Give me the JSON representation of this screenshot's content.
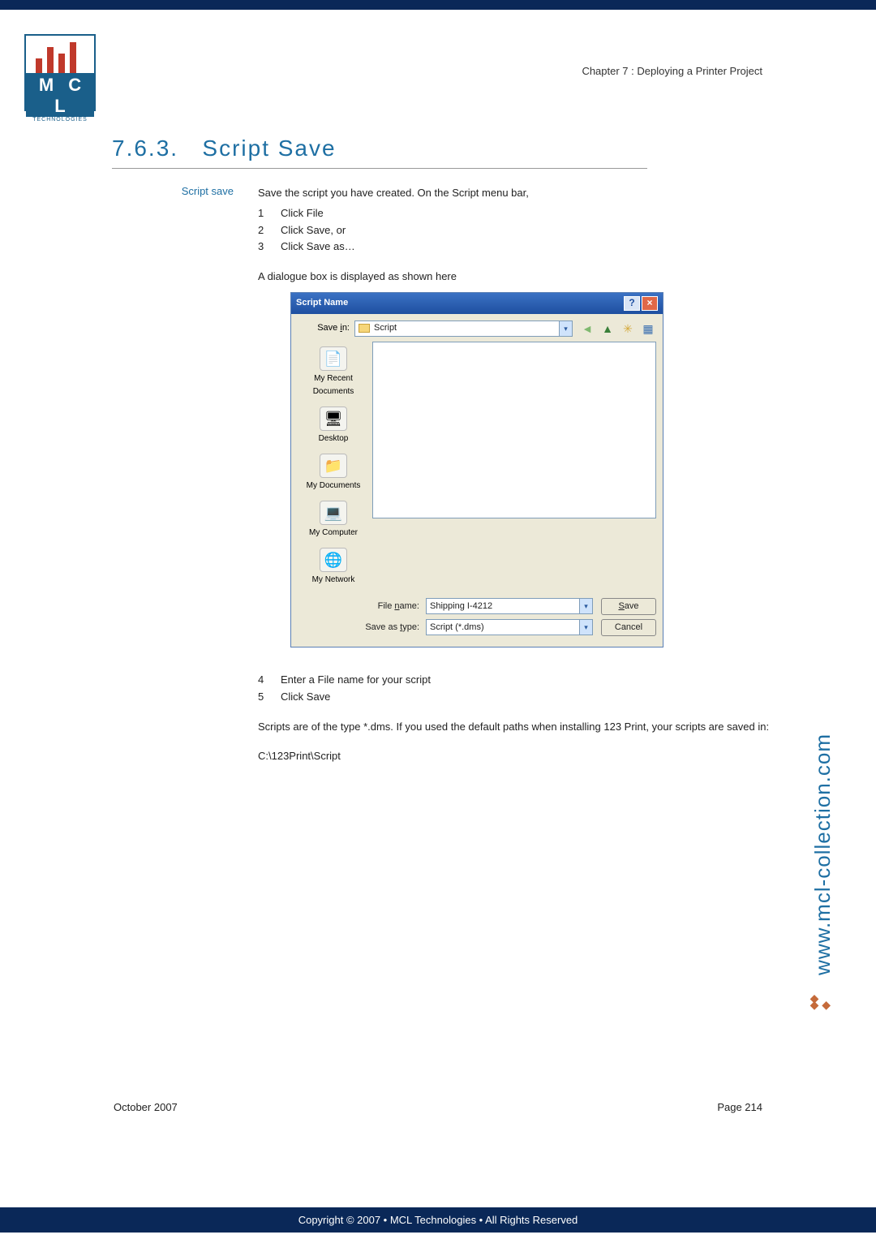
{
  "header": {
    "chapter": "Chapter 7 : Deploying a Printer Project"
  },
  "logo": {
    "initials": "M C L",
    "sub": "TECHNOLOGIES"
  },
  "section": {
    "number": "7.6.3.",
    "title": "Script Save"
  },
  "leftLabel": "Script save",
  "body": {
    "intro": "Save the script you have created. On the Script menu bar,",
    "steps1": [
      {
        "n": "1",
        "t": "Click File"
      },
      {
        "n": "2",
        "t": "Click Save, or"
      },
      {
        "n": "3",
        "t": "Click Save as…"
      }
    ],
    "dlgNote": "A dialogue box is displayed as shown here",
    "steps2": [
      {
        "n": "4",
        "t": "Enter a File name for your script"
      },
      {
        "n": "5",
        "t": "Click Save"
      }
    ],
    "pathnote": "Scripts are of the type *.dms. If you used the default paths when installing 123 Print, your scripts are saved in:",
    "codepath": "C:\\123Print\\Script"
  },
  "dialog": {
    "title": "Script Name",
    "saveInLabel": "Save in:",
    "saveInValue": "Script",
    "places": [
      "My Recent Documents",
      "Desktop",
      "My Documents",
      "My Computer",
      "My Network"
    ],
    "fileNameLabel": "File name:",
    "fileNameValue": "Shipping I-4212",
    "saveTypeLabel": "Save as type:",
    "saveTypeValue": "Script (*.dms)",
    "saveBtn": "Save",
    "cancelBtn": "Cancel"
  },
  "sideUrl": "www.mcl-collection.com",
  "footer": {
    "date": "October 2007",
    "page": "Page 214"
  },
  "copyright": "Copyright © 2007 • MCL Technologies • All Rights Reserved"
}
